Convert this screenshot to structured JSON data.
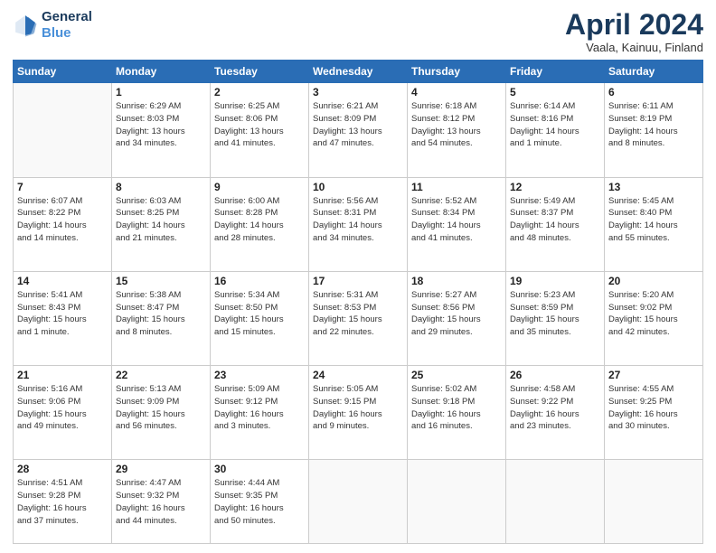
{
  "header": {
    "logo_line1": "General",
    "logo_line2": "Blue",
    "month_title": "April 2024",
    "location": "Vaala, Kainuu, Finland"
  },
  "days_of_week": [
    "Sunday",
    "Monday",
    "Tuesday",
    "Wednesday",
    "Thursday",
    "Friday",
    "Saturday"
  ],
  "weeks": [
    [
      {
        "day": "",
        "detail": ""
      },
      {
        "day": "1",
        "detail": "Sunrise: 6:29 AM\nSunset: 8:03 PM\nDaylight: 13 hours\nand 34 minutes."
      },
      {
        "day": "2",
        "detail": "Sunrise: 6:25 AM\nSunset: 8:06 PM\nDaylight: 13 hours\nand 41 minutes."
      },
      {
        "day": "3",
        "detail": "Sunrise: 6:21 AM\nSunset: 8:09 PM\nDaylight: 13 hours\nand 47 minutes."
      },
      {
        "day": "4",
        "detail": "Sunrise: 6:18 AM\nSunset: 8:12 PM\nDaylight: 13 hours\nand 54 minutes."
      },
      {
        "day": "5",
        "detail": "Sunrise: 6:14 AM\nSunset: 8:16 PM\nDaylight: 14 hours\nand 1 minute."
      },
      {
        "day": "6",
        "detail": "Sunrise: 6:11 AM\nSunset: 8:19 PM\nDaylight: 14 hours\nand 8 minutes."
      }
    ],
    [
      {
        "day": "7",
        "detail": "Sunrise: 6:07 AM\nSunset: 8:22 PM\nDaylight: 14 hours\nand 14 minutes."
      },
      {
        "day": "8",
        "detail": "Sunrise: 6:03 AM\nSunset: 8:25 PM\nDaylight: 14 hours\nand 21 minutes."
      },
      {
        "day": "9",
        "detail": "Sunrise: 6:00 AM\nSunset: 8:28 PM\nDaylight: 14 hours\nand 28 minutes."
      },
      {
        "day": "10",
        "detail": "Sunrise: 5:56 AM\nSunset: 8:31 PM\nDaylight: 14 hours\nand 34 minutes."
      },
      {
        "day": "11",
        "detail": "Sunrise: 5:52 AM\nSunset: 8:34 PM\nDaylight: 14 hours\nand 41 minutes."
      },
      {
        "day": "12",
        "detail": "Sunrise: 5:49 AM\nSunset: 8:37 PM\nDaylight: 14 hours\nand 48 minutes."
      },
      {
        "day": "13",
        "detail": "Sunrise: 5:45 AM\nSunset: 8:40 PM\nDaylight: 14 hours\nand 55 minutes."
      }
    ],
    [
      {
        "day": "14",
        "detail": "Sunrise: 5:41 AM\nSunset: 8:43 PM\nDaylight: 15 hours\nand 1 minute."
      },
      {
        "day": "15",
        "detail": "Sunrise: 5:38 AM\nSunset: 8:47 PM\nDaylight: 15 hours\nand 8 minutes."
      },
      {
        "day": "16",
        "detail": "Sunrise: 5:34 AM\nSunset: 8:50 PM\nDaylight: 15 hours\nand 15 minutes."
      },
      {
        "day": "17",
        "detail": "Sunrise: 5:31 AM\nSunset: 8:53 PM\nDaylight: 15 hours\nand 22 minutes."
      },
      {
        "day": "18",
        "detail": "Sunrise: 5:27 AM\nSunset: 8:56 PM\nDaylight: 15 hours\nand 29 minutes."
      },
      {
        "day": "19",
        "detail": "Sunrise: 5:23 AM\nSunset: 8:59 PM\nDaylight: 15 hours\nand 35 minutes."
      },
      {
        "day": "20",
        "detail": "Sunrise: 5:20 AM\nSunset: 9:02 PM\nDaylight: 15 hours\nand 42 minutes."
      }
    ],
    [
      {
        "day": "21",
        "detail": "Sunrise: 5:16 AM\nSunset: 9:06 PM\nDaylight: 15 hours\nand 49 minutes."
      },
      {
        "day": "22",
        "detail": "Sunrise: 5:13 AM\nSunset: 9:09 PM\nDaylight: 15 hours\nand 56 minutes."
      },
      {
        "day": "23",
        "detail": "Sunrise: 5:09 AM\nSunset: 9:12 PM\nDaylight: 16 hours\nand 3 minutes."
      },
      {
        "day": "24",
        "detail": "Sunrise: 5:05 AM\nSunset: 9:15 PM\nDaylight: 16 hours\nand 9 minutes."
      },
      {
        "day": "25",
        "detail": "Sunrise: 5:02 AM\nSunset: 9:18 PM\nDaylight: 16 hours\nand 16 minutes."
      },
      {
        "day": "26",
        "detail": "Sunrise: 4:58 AM\nSunset: 9:22 PM\nDaylight: 16 hours\nand 23 minutes."
      },
      {
        "day": "27",
        "detail": "Sunrise: 4:55 AM\nSunset: 9:25 PM\nDaylight: 16 hours\nand 30 minutes."
      }
    ],
    [
      {
        "day": "28",
        "detail": "Sunrise: 4:51 AM\nSunset: 9:28 PM\nDaylight: 16 hours\nand 37 minutes."
      },
      {
        "day": "29",
        "detail": "Sunrise: 4:47 AM\nSunset: 9:32 PM\nDaylight: 16 hours\nand 44 minutes."
      },
      {
        "day": "30",
        "detail": "Sunrise: 4:44 AM\nSunset: 9:35 PM\nDaylight: 16 hours\nand 50 minutes."
      },
      {
        "day": "",
        "detail": ""
      },
      {
        "day": "",
        "detail": ""
      },
      {
        "day": "",
        "detail": ""
      },
      {
        "day": "",
        "detail": ""
      }
    ]
  ]
}
